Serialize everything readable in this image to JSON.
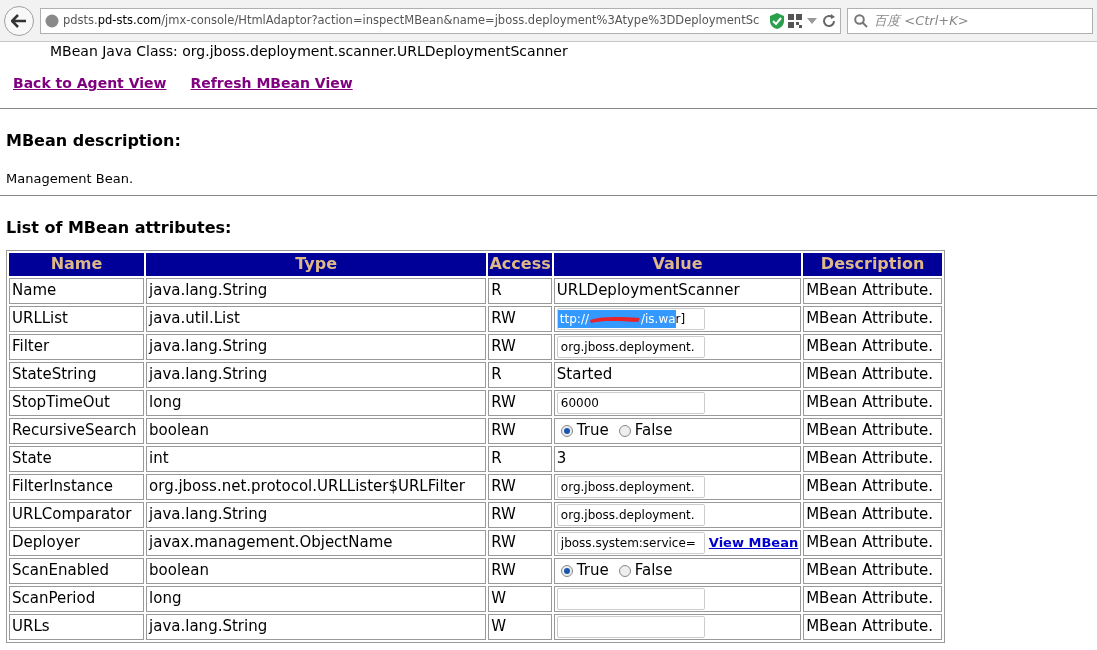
{
  "browser": {
    "url_host_prefix": "pdsts.",
    "url_host_domain": "pd-sts.com",
    "url_path": "/jmx-console/HtmlAdaptor?action=inspectMBean&name=jboss.deployment%3Atype%3DDeploymentSc",
    "search_placeholder": "百度 <Ctrl+K>"
  },
  "page": {
    "class_line": "MBean Java Class: org.jboss.deployment.scanner.URLDeploymentScanner",
    "links": [
      "Back to Agent View",
      "Refresh MBean View"
    ],
    "description_heading": "MBean description:",
    "description": "Management Bean.",
    "attributes_heading": "List of MBean attributes:",
    "columns": [
      "Name",
      "Type",
      "Access",
      "Value",
      "Description"
    ],
    "rows": [
      {
        "name": "Name",
        "type": "java.lang.String",
        "access": "R",
        "kind": "text",
        "value": "URLDeploymentScanner",
        "description": "MBean Attribute."
      },
      {
        "name": "URLList",
        "type": "java.util.List",
        "access": "RW",
        "kind": "redacted_input",
        "value_start": "ttp://",
        "value_end": "/is.wa",
        "value_tail": "r]",
        "description": "MBean Attribute."
      },
      {
        "name": "Filter",
        "type": "java.lang.String",
        "access": "RW",
        "kind": "input",
        "value": "org.jboss.deployment.",
        "description": "MBean Attribute."
      },
      {
        "name": "StateString",
        "type": "java.lang.String",
        "access": "R",
        "kind": "text",
        "value": "Started",
        "description": "MBean Attribute."
      },
      {
        "name": "StopTimeOut",
        "type": "long",
        "access": "RW",
        "kind": "input",
        "value": "60000",
        "description": "MBean Attribute."
      },
      {
        "name": "RecursiveSearch",
        "type": "boolean",
        "access": "RW",
        "kind": "radio",
        "options": [
          {
            "label": "True",
            "selected": true
          },
          {
            "label": "False",
            "selected": false
          }
        ],
        "description": "MBean Attribute."
      },
      {
        "name": "State",
        "type": "int",
        "access": "R",
        "kind": "text",
        "value": "3",
        "description": "MBean Attribute."
      },
      {
        "name": "FilterInstance",
        "type": "org.jboss.net.protocol.URLLister$URLFilter",
        "access": "RW",
        "kind": "input",
        "value": "org.jboss.deployment.",
        "description": "MBean Attribute."
      },
      {
        "name": "URLComparator",
        "type": "java.lang.String",
        "access": "RW",
        "kind": "input",
        "value": "org.jboss.deployment.",
        "description": "MBean Attribute."
      },
      {
        "name": "Deployer",
        "type": "javax.management.ObjectName",
        "access": "RW",
        "kind": "input_link",
        "value": "jboss.system:service=",
        "link": "View MBean",
        "description": "MBean Attribute."
      },
      {
        "name": "ScanEnabled",
        "type": "boolean",
        "access": "RW",
        "kind": "radio",
        "options": [
          {
            "label": "True",
            "selected": true
          },
          {
            "label": "False",
            "selected": false
          }
        ],
        "description": "MBean Attribute."
      },
      {
        "name": "ScanPeriod",
        "type": "long",
        "access": "W",
        "kind": "input",
        "description": "MBean Attribute."
      },
      {
        "name": "URLs",
        "type": "java.lang.String",
        "access": "W",
        "kind": "input",
        "description": "MBean Attribute."
      }
    ]
  }
}
